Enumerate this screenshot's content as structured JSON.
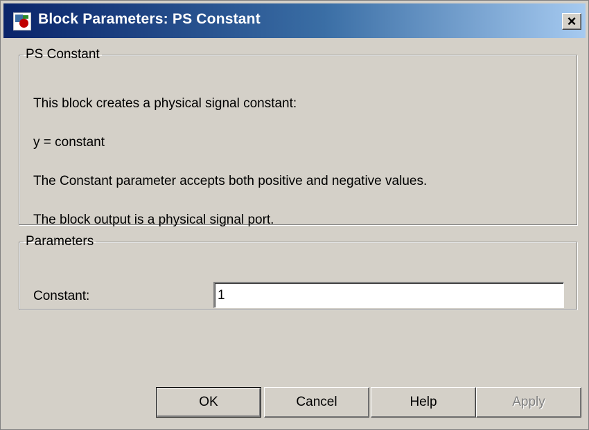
{
  "window": {
    "title": "Block Parameters: PS Constant",
    "close_label": "×",
    "icon": "simulink-block-icon"
  },
  "description_group": {
    "legend": "PS Constant",
    "lines": [
      "This block creates a physical signal constant:",
      "y = constant",
      "The Constant parameter accepts both positive and negative values.",
      "The block output is a physical signal port."
    ]
  },
  "parameters_group": {
    "legend": "Parameters",
    "constant_label": "Constant:",
    "constant_value": "1"
  },
  "buttons": {
    "ok": "OK",
    "cancel": "Cancel",
    "help": "Help",
    "apply": "Apply"
  }
}
